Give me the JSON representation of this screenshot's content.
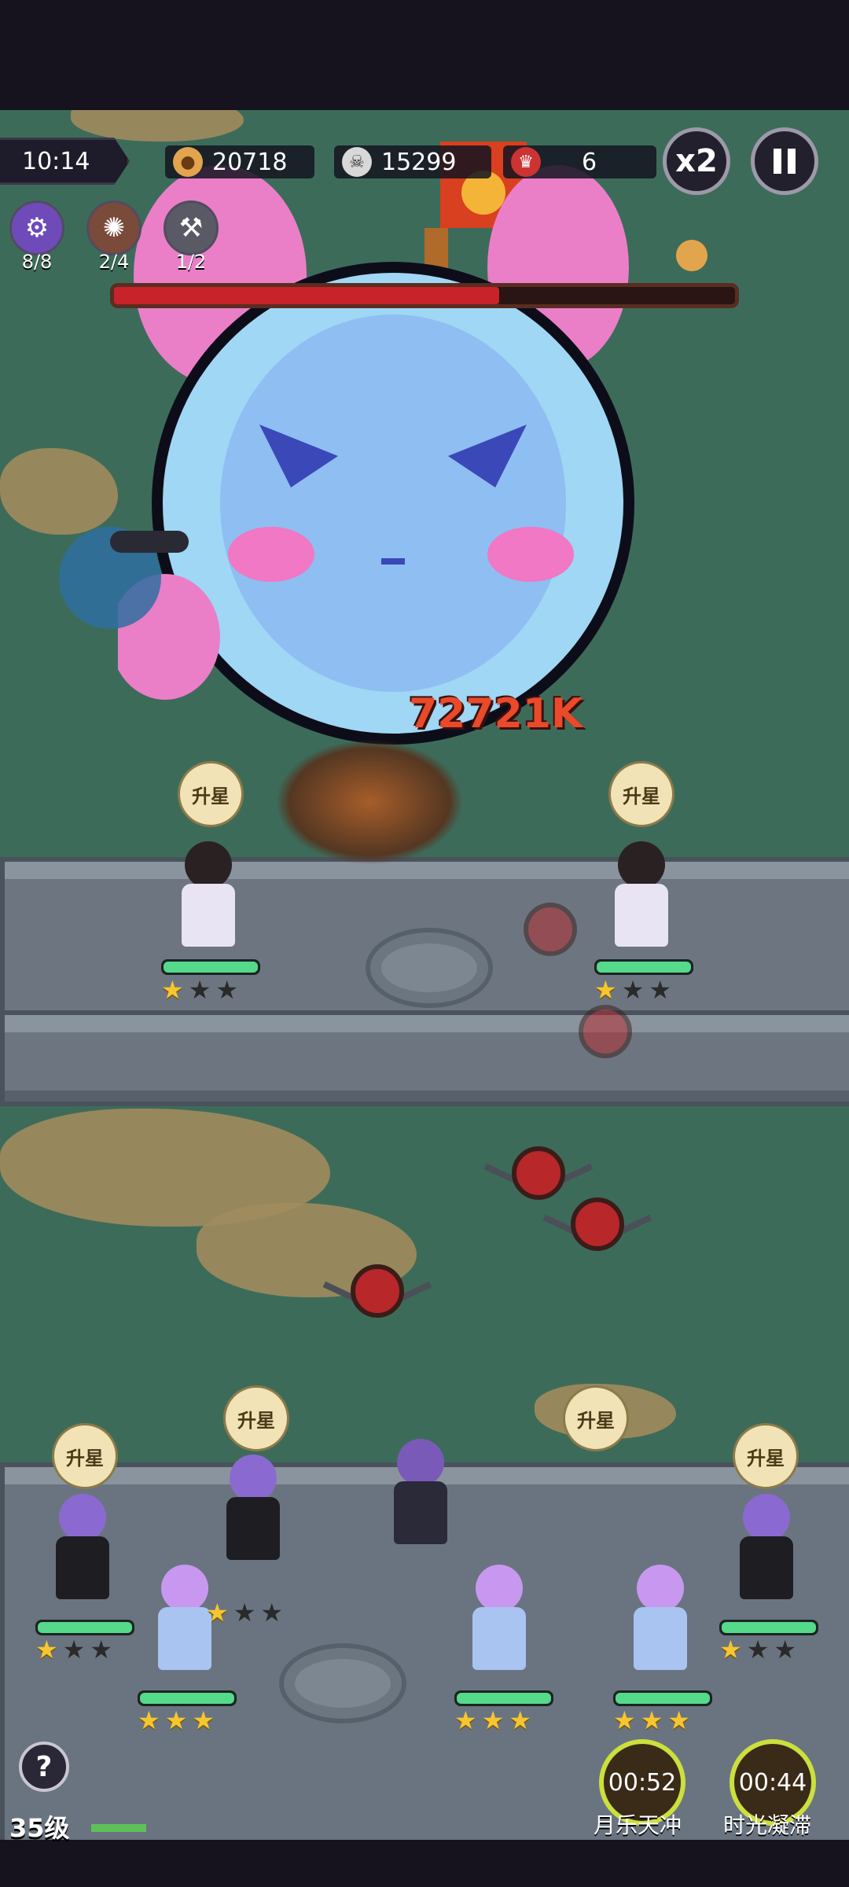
{
  "hud": {
    "time": "10:14",
    "coins": "20718",
    "kills": "15299",
    "boss_count": "6",
    "speed": "x2",
    "pause_icon": "pause-icon"
  },
  "skills": [
    {
      "count": "8/8",
      "icon": "gear-icon",
      "color": "#6e4bb8"
    },
    {
      "count": "2/4",
      "icon": "swirl-blades-icon",
      "color": "#7a4a3a"
    },
    {
      "count": "1/2",
      "icon": "hammer-icon",
      "color": "#5a5a66"
    }
  ],
  "boss": {
    "health": 0.62,
    "damage_text": "72721K"
  },
  "upgrade_label": "升星",
  "top_heroes": [
    {
      "stars": 1,
      "hp": 1.0
    },
    {
      "stars": 1,
      "hp": 1.0
    }
  ],
  "bottom_heroes": [
    {
      "stars": 1,
      "hp": 1.0
    },
    {
      "stars": 3,
      "hp": 1.0
    },
    {
      "stars": 1,
      "hp": 1.0
    },
    {
      "stars": 3,
      "hp": 1.0
    },
    {
      "stars": 3,
      "hp": 1.0
    },
    {
      "stars": 1,
      "hp": 1.0
    }
  ],
  "footer": {
    "help": "?",
    "level": "35级",
    "abilities": [
      {
        "timer": "00:52",
        "name": "月乐天冲"
      },
      {
        "timer": "00:44",
        "name": "时光凝滞"
      }
    ]
  },
  "colors": {
    "grass": "#3d6b5a",
    "boss_bar": "#c8222a",
    "hp": "#55d98a",
    "star": "#f6c630"
  }
}
